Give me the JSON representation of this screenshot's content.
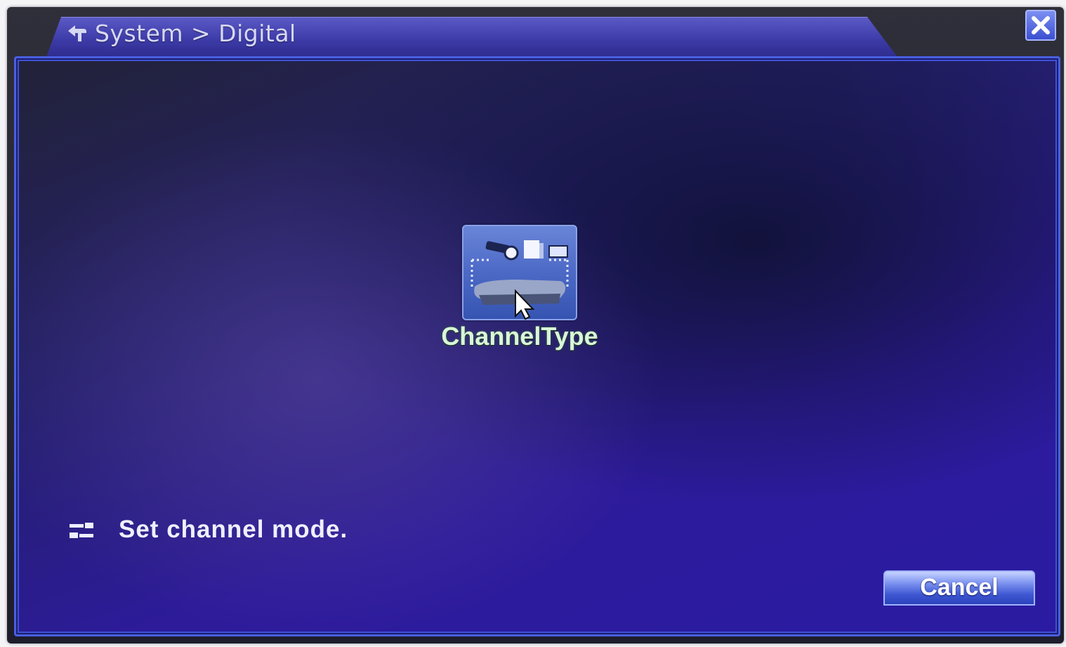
{
  "window": {
    "breadcrumb": "System > Digital"
  },
  "main": {
    "menu_item": {
      "label": "ChannelType",
      "icon": "channel-type-icon"
    },
    "hint": "Set channel mode."
  },
  "footer": {
    "cancel_label": "Cancel"
  },
  "colors": {
    "accent": "#4a5fe0",
    "panel_background": "#2a1ba2",
    "label_green": "#d8f7d8"
  }
}
